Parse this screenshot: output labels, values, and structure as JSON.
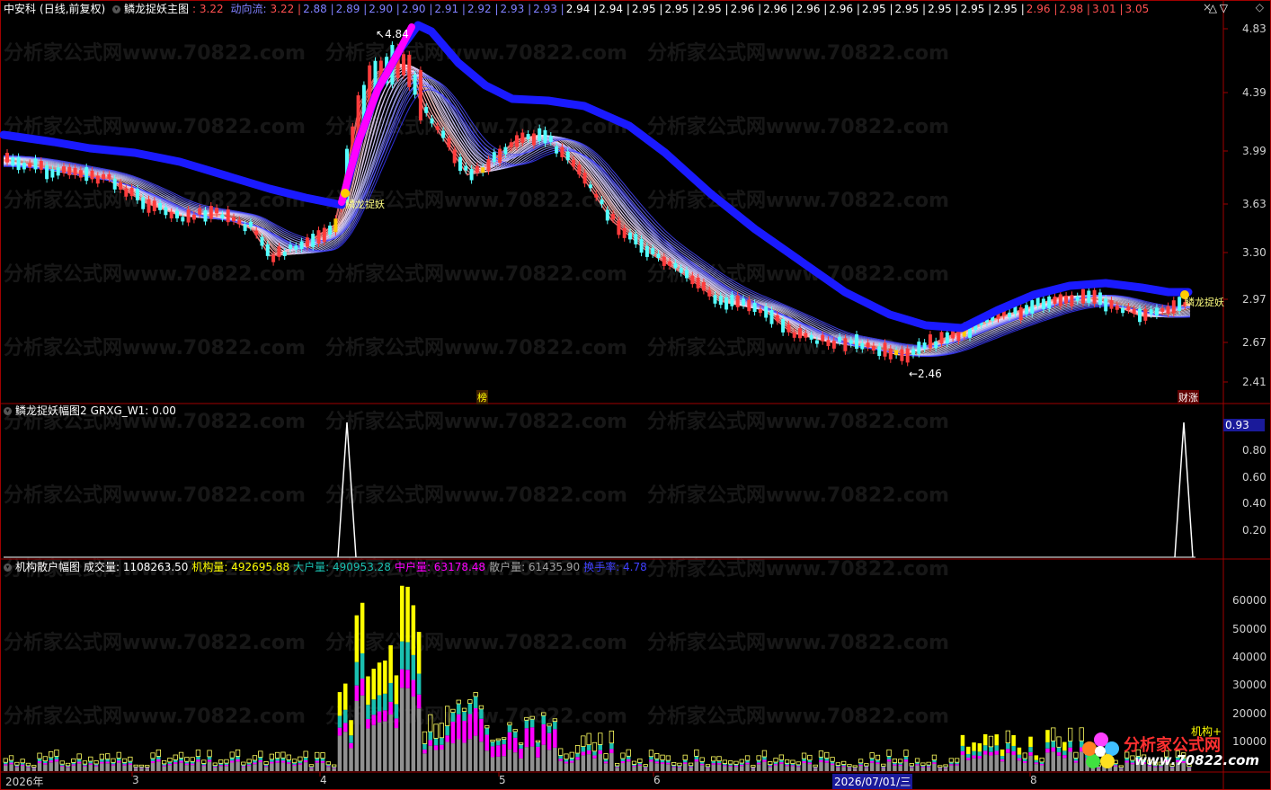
{
  "main": {
    "stock": "中安科",
    "period_mode": "(日线,前复权)",
    "indicator_name": "鳞龙捉妖主图",
    "indicator_value": ": 3.22",
    "flow_label": "动向流:",
    "flow_values": [
      "3.22",
      "2.88",
      "2.89",
      "2.90",
      "2.90",
      "2.91",
      "2.92",
      "2.93",
      "2.93",
      "2.94",
      "2.94",
      "2.95",
      "2.95",
      "2.95",
      "2.96",
      "2.96",
      "2.96",
      "2.96",
      "2.95",
      "2.95",
      "2.95",
      "2.95",
      "2.95",
      "2.96",
      "2.98",
      "3.01",
      "3.05"
    ],
    "price_labels": [
      "4.83",
      "4.39",
      "3.99",
      "3.63",
      "3.30",
      "2.97",
      "2.67",
      "2.41"
    ],
    "high_annot": "4.84",
    "low_annot": "←2.46",
    "signal_label": "鳞龙捉妖",
    "bottom_tags": [
      "榜",
      "财涨"
    ]
  },
  "sub1": {
    "title": "鳞龙捉妖幅图2",
    "series_label": "GRXG_W1: 0.00",
    "current_value": "0.93",
    "axis_labels": [
      "0.80",
      "0.60",
      "0.40",
      "0.20"
    ]
  },
  "sub2": {
    "title": "机构散户幅图",
    "vol_label": "成交量: 1108263.50",
    "inst_label": "机构量: 492695.88",
    "big_label": "大户量: 490953.28",
    "mid_label": "中户量: 63178.48",
    "retail_label": "散户量: 61435.90",
    "turnover_label": "换手率: 4.78",
    "axis_labels": [
      "60000",
      "50000",
      "40000",
      "30000",
      "20000",
      "10000"
    ],
    "tag": "机构+"
  },
  "time_axis": {
    "labels": [
      "2026年",
      "3",
      "4",
      "5",
      "6",
      "2026/07/01/三",
      "8"
    ]
  },
  "watermark": "分析家公式网www.70822.com",
  "logo": {
    "text": "分析家公式网",
    "url": "www.70822.com"
  },
  "colors": {
    "up": "#ff3c3c",
    "down": "#54ffff",
    "blue_line": "#1a1aff",
    "magenta": "#ff00ff",
    "yellow": "#ffff00",
    "axis_red": "#a00000"
  }
}
